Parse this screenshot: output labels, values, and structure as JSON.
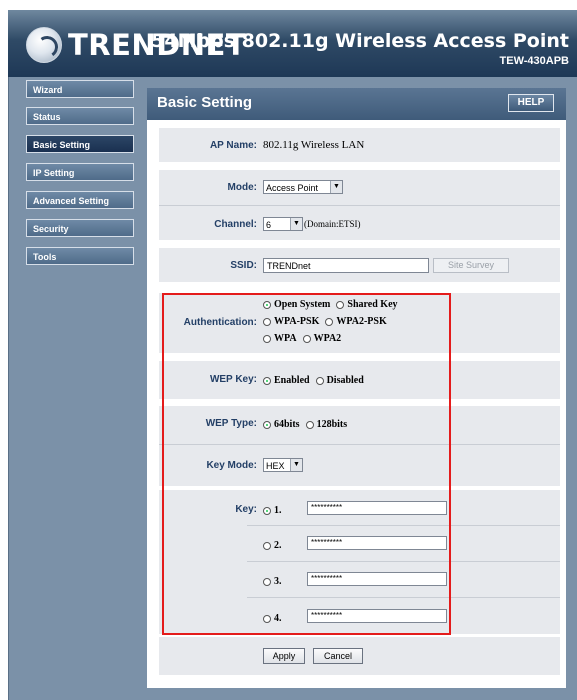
{
  "header": {
    "brand": "TRENDNET",
    "product": "54Mbps 802.11g Wireless Access Point",
    "model": "TEW-430APB"
  },
  "nav": [
    {
      "label": "Wizard"
    },
    {
      "label": "Status"
    },
    {
      "label": "Basic Setting"
    },
    {
      "label": "IP Setting"
    },
    {
      "label": "Advanced Setting"
    },
    {
      "label": "Security"
    },
    {
      "label": "Tools"
    }
  ],
  "page": {
    "title": "Basic Setting",
    "help_label": "HELP"
  },
  "ap_name": {
    "label": "AP Name:",
    "value": "802.11g Wireless LAN"
  },
  "mode": {
    "label": "Mode:",
    "value": "Access Point"
  },
  "channel": {
    "label": "Channel:",
    "value": "6",
    "domain": "(Domain:ETSI)"
  },
  "ssid": {
    "label": "SSID:",
    "value": "TRENDnet",
    "survey_label": "Site Survey"
  },
  "authentication": {
    "label": "Authentication:",
    "options": [
      "Open System",
      "Shared Key",
      "WPA-PSK",
      "WPA2-PSK",
      "WPA",
      "WPA2"
    ],
    "selected": "Open System"
  },
  "wep_key": {
    "label": "WEP Key:",
    "options": [
      "Enabled",
      "Disabled"
    ],
    "selected": "Enabled"
  },
  "wep_type": {
    "label": "WEP Type:",
    "options": [
      "64bits",
      "128bits"
    ],
    "selected": "64bits"
  },
  "key_mode": {
    "label": "Key Mode:",
    "value": "HEX"
  },
  "keys": {
    "label": "Key:",
    "items": [
      {
        "index": "1.",
        "value": "**********"
      },
      {
        "index": "2.",
        "value": "**********"
      },
      {
        "index": "3.",
        "value": "**********"
      },
      {
        "index": "4.",
        "value": "**********"
      }
    ],
    "selected": "1."
  },
  "actions": {
    "apply": "Apply",
    "cancel": "Cancel"
  },
  "colors": {
    "highlight_box": "#e41b1b",
    "label_text": "#233f66",
    "header_dark": "#1e3856"
  }
}
